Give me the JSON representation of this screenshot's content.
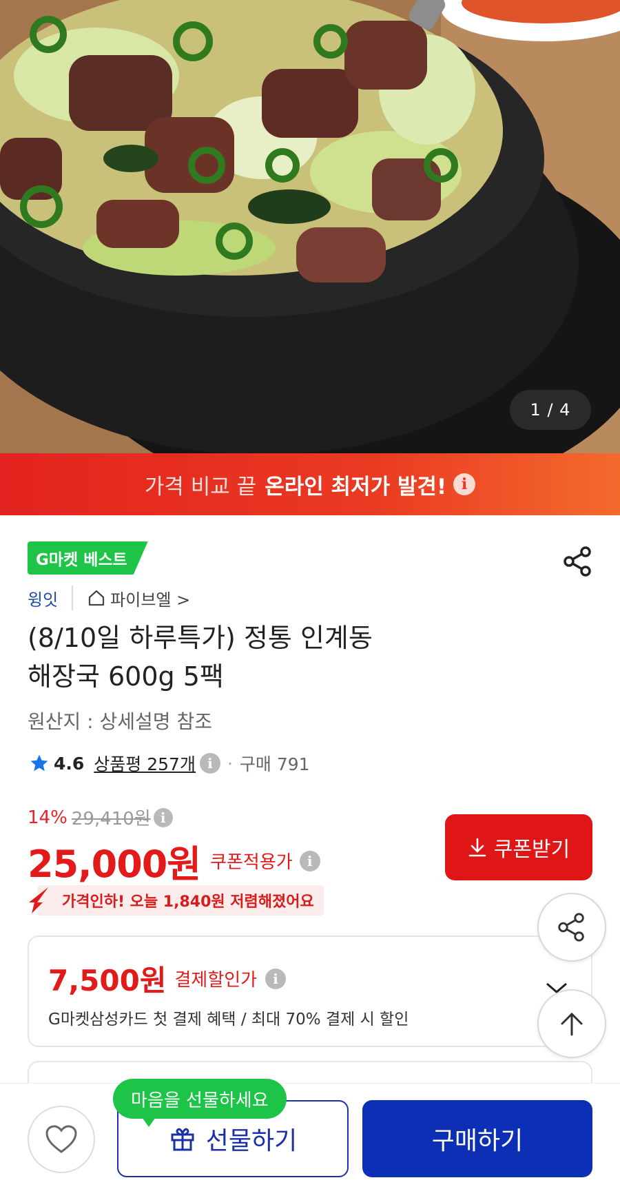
{
  "hero": {
    "image_description": "",
    "counter": "1 / 4"
  },
  "promo": {
    "text_light": "가격 비교 끝",
    "text_bold": "온라인 최저가 발견!",
    "info_icon": "info-icon"
  },
  "product": {
    "badge": "G마켓 베스트",
    "brand": "윙잇",
    "store": "파이브엘 >",
    "title_line1": "(8/10일 하루특가) 정통 인계동",
    "title_line2": "해장국 600g 5팩",
    "origin": "원산지 : 상세설명 참조",
    "rating": "4.6",
    "reviews": "상품평 257개",
    "purchases": "구매 791"
  },
  "price": {
    "discount_pct": "14%",
    "original": "29,410원",
    "current": "25,000원",
    "current_note": "쿠폰적용가",
    "coupon_button": "쿠폰받기",
    "drop_notice": "가격인하! 오늘 1,840원 저렴해졌어요"
  },
  "payment_card": {
    "amount": "7,500원",
    "note": "결제할인가",
    "desc": "G마켓삼성카드 첫 결제 혜택 / 최대 70% 결제 시 할인"
  },
  "bottom": {
    "tooltip": "마음을 선물하세요",
    "gift_button": "선물하기",
    "buy_button": "구매하기"
  },
  "colors": {
    "accent_red": "#e21a1a",
    "badge_green": "#1ec447",
    "brand_blue": "#0c2fb5"
  }
}
